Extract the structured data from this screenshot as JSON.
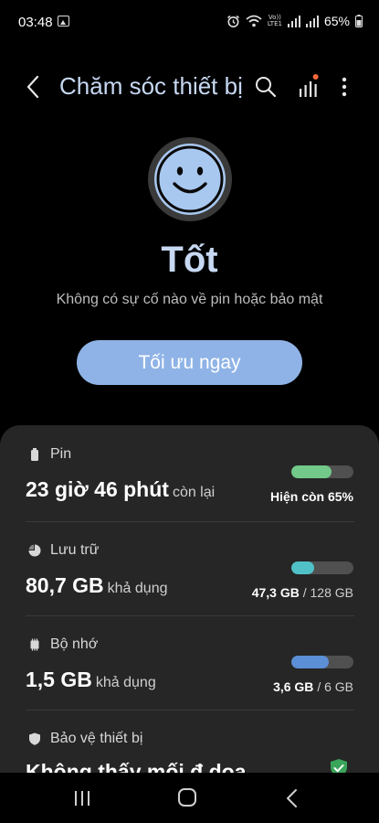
{
  "status_bar": {
    "time": "03:48",
    "network_label_top": "Vo))",
    "network_label_bottom": "LTE1",
    "battery_percent": "65%",
    "icons": [
      "photo-icon",
      "alarm-icon",
      "wifi-icon",
      "volte-icon",
      "signal-icon",
      "signal-icon",
      "battery-icon"
    ]
  },
  "header": {
    "title": "Chăm sóc thiết bị",
    "icons": [
      "back-icon",
      "search-icon",
      "stats-icon",
      "more-icon"
    ],
    "notification_dot_color": "#ff6a3d"
  },
  "hero": {
    "status_icon": "smiley-face-icon",
    "status": "Tốt",
    "description": "Không có sự cố nào về pin hoặc bảo mật",
    "optimize_button": "Tối ưu ngay"
  },
  "sections": {
    "battery": {
      "icon": "battery-icon",
      "label": "Pin",
      "value": "23 giờ 46 phút",
      "value_suffix": "còn lại",
      "right_text": "Hiện còn 65%",
      "progress": 0.65,
      "bar_color": "#72c98a"
    },
    "storage": {
      "icon": "pie-chart-icon",
      "label": "Lưu trữ",
      "value": "80,7 GB",
      "value_suffix": "khả dụng",
      "used": "47,3 GB",
      "separator": "/",
      "total": "128 GB",
      "progress": 0.37,
      "bar_color": "#4fc1c7"
    },
    "memory": {
      "icon": "chip-icon",
      "label": "Bộ nhớ",
      "value": "1,5 GB",
      "value_suffix": "khả dụng",
      "used": "3,6 GB",
      "separator": "/",
      "total": "6 GB",
      "progress": 0.6,
      "bar_color": "#5b8fd6"
    },
    "security": {
      "icon": "shield-icon",
      "label": "Bảo vệ thiết bị",
      "value": "Không thấy mối đ dọa",
      "status_icon": "shield-check-icon",
      "status_color": "#3aa55a"
    }
  },
  "nav_bar": {
    "icons": [
      "recents-icon",
      "home-icon",
      "back-icon"
    ]
  }
}
